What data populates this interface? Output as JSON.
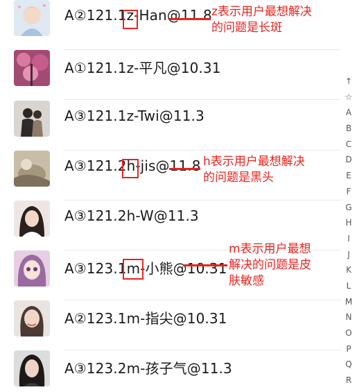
{
  "contacts": [
    {
      "name": "A②121.1z-Han@11.8"
    },
    {
      "name": "A①121.1z-平凡@10.31"
    },
    {
      "name": "A③121.1z-Twi@11.3"
    },
    {
      "name": "A③121.2h-jis@11.8"
    },
    {
      "name": "A③121.2h-W@11.3"
    },
    {
      "name": "A③123.1m-小熊@10.31"
    },
    {
      "name": "A②123.1m-指尖@10.31"
    },
    {
      "name": "A③123.2m-孩子气@11.3"
    }
  ],
  "annotations": {
    "z_line1": "z表示用户最想解决",
    "z_line2": "的问题是长斑",
    "h_line1": "h表示用户最想解决",
    "h_line2": "的问题是黑头",
    "m_line1": "m表示用户最想",
    "m_line2": "解决的问题是皮",
    "m_line3": "肤敏感"
  },
  "index_bar": [
    "↑",
    "☆",
    "A",
    "B",
    "C",
    "D",
    "E",
    "F",
    "G",
    "H",
    "I",
    "J",
    "K",
    "L",
    "M",
    "N",
    "O",
    "P",
    "Q",
    "R"
  ],
  "colors": {
    "annotation": "#e8231f",
    "text": "#1a1a1a",
    "divider": "#e8e8e8"
  }
}
